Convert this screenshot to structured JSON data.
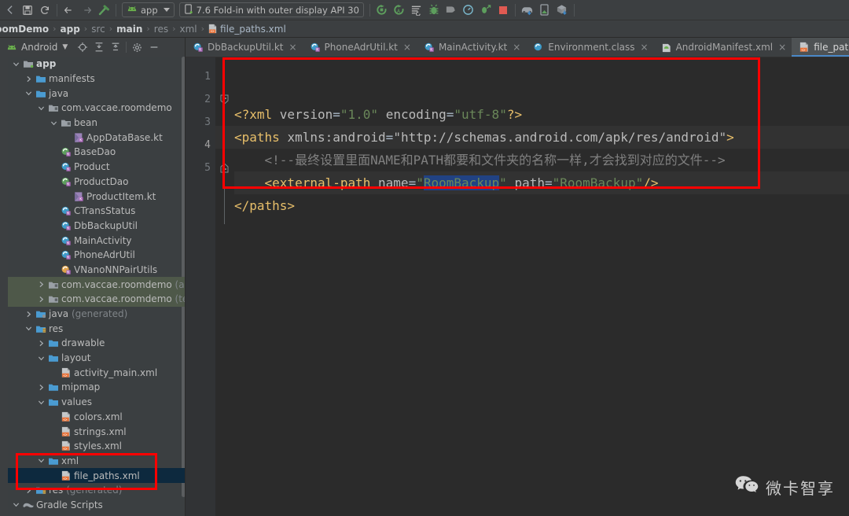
{
  "toolbar": {
    "icons": [
      "back-nav-icon",
      "save-icon",
      "sync-icon",
      "arrow-left-icon",
      "arrow-right-icon",
      "build-hammer-icon"
    ],
    "module_selector": {
      "label": "app",
      "icon": "android-icon"
    },
    "device_selector": {
      "label": "7.6  Fold-in with outer display API 30",
      "icon": "device-icon"
    },
    "run_icons": [
      "run-icon",
      "run-with-coverage-icon",
      "logcat-icon",
      "debug-icon",
      "attach-debugger-icon",
      "profiler-icon",
      "apply-changes-icon",
      "stop-icon"
    ],
    "right_icons": [
      "avd-manager-icon",
      "device-manager-icon",
      "sdk-manager-icon"
    ]
  },
  "breadcrumb": {
    "items": [
      {
        "label": "RoomDemo",
        "style": "bold"
      },
      {
        "label": "app",
        "style": "bold"
      },
      {
        "label": "src",
        "style": "dim"
      },
      {
        "label": "main",
        "style": "bold"
      },
      {
        "label": "res",
        "style": "dim"
      },
      {
        "label": "xml",
        "style": "dim"
      },
      {
        "label": "file_paths.xml",
        "style": "file",
        "icon": "xml-file-icon"
      }
    ],
    "separator": "›"
  },
  "project_panel": {
    "title": "Android",
    "title_icon": "android-icon",
    "caret": "▾",
    "toolbar_icons": [
      "select-opened-file-icon",
      "expand-all-icon",
      "collapse-all-icon",
      "settings-gear-icon",
      "hide-icon"
    ],
    "tree": [
      {
        "depth": 0,
        "arrow": "down",
        "icon": "module-folder",
        "label": "app",
        "bold": true
      },
      {
        "depth": 1,
        "arrow": "right",
        "icon": "folder",
        "label": "manifests"
      },
      {
        "depth": 1,
        "arrow": "down",
        "icon": "folder",
        "label": "java"
      },
      {
        "depth": 2,
        "arrow": "down",
        "icon": "package",
        "label": "com.vaccae.roomdemo"
      },
      {
        "depth": 3,
        "arrow": "down",
        "icon": "package",
        "label": "bean"
      },
      {
        "depth": 4,
        "arrow": "none",
        "icon": "kotlin-class",
        "label": "AppDataBase.kt"
      },
      {
        "depth": 3,
        "arrow": "none",
        "icon": "kotlin-green",
        "label": "BaseDao"
      },
      {
        "depth": 3,
        "arrow": "none",
        "icon": "kotlin-blue",
        "label": "Product"
      },
      {
        "depth": 3,
        "arrow": "none",
        "icon": "kotlin-green",
        "label": "ProductDao"
      },
      {
        "depth": 4,
        "arrow": "none",
        "icon": "kotlin-class",
        "label": "ProductItem.kt"
      },
      {
        "depth": 3,
        "arrow": "none",
        "icon": "kotlin-blue",
        "label": "CTransStatus"
      },
      {
        "depth": 3,
        "arrow": "none",
        "icon": "kotlin-blue",
        "label": "DbBackupUtil"
      },
      {
        "depth": 3,
        "arrow": "none",
        "icon": "kotlin-blue",
        "label": "MainActivity"
      },
      {
        "depth": 3,
        "arrow": "none",
        "icon": "kotlin-blue",
        "label": "PhoneAdrUtil"
      },
      {
        "depth": 3,
        "arrow": "none",
        "icon": "kotlin-orange",
        "label": "VNanoNNPairUtils"
      },
      {
        "depth": 2,
        "arrow": "right",
        "icon": "package",
        "label": "com.vaccae.roomdemo",
        "suffix": " (andr",
        "highlight": "green"
      },
      {
        "depth": 2,
        "arrow": "right",
        "icon": "package",
        "label": "com.vaccae.roomdemo",
        "suffix": " (test)",
        "highlight": "green"
      },
      {
        "depth": 1,
        "arrow": "right",
        "icon": "folder-gen",
        "label": "java",
        "suffix": " (generated)"
      },
      {
        "depth": 1,
        "arrow": "down",
        "icon": "res-folder",
        "label": "res"
      },
      {
        "depth": 2,
        "arrow": "right",
        "icon": "folder",
        "label": "drawable"
      },
      {
        "depth": 2,
        "arrow": "down",
        "icon": "folder",
        "label": "layout"
      },
      {
        "depth": 3,
        "arrow": "none",
        "icon": "xml-file",
        "label": "activity_main.xml"
      },
      {
        "depth": 2,
        "arrow": "right",
        "icon": "folder",
        "label": "mipmap"
      },
      {
        "depth": 2,
        "arrow": "down",
        "icon": "folder",
        "label": "values"
      },
      {
        "depth": 3,
        "arrow": "none",
        "icon": "xml-file",
        "label": "colors.xml"
      },
      {
        "depth": 3,
        "arrow": "none",
        "icon": "xml-file",
        "label": "strings.xml"
      },
      {
        "depth": 3,
        "arrow": "none",
        "icon": "xml-file",
        "label": "styles.xml"
      },
      {
        "depth": 2,
        "arrow": "down",
        "icon": "folder",
        "label": "xml"
      },
      {
        "depth": 3,
        "arrow": "none",
        "icon": "xml-file",
        "label": "file_paths.xml",
        "highlight": "blue"
      },
      {
        "depth": 1,
        "arrow": "right",
        "icon": "res-folder",
        "label": "res",
        "suffix": " (generated)"
      },
      {
        "depth": 0,
        "arrow": "down",
        "icon": "gradle",
        "label": "Gradle Scripts"
      }
    ]
  },
  "editor_tabs": [
    {
      "label": "DbBackupUtil.kt",
      "icon": "kotlin-blue",
      "active": false,
      "close": "×"
    },
    {
      "label": "PhoneAdrUtil.kt",
      "icon": "kotlin-blue",
      "active": false,
      "close": "×"
    },
    {
      "label": "MainActivity.kt",
      "icon": "kotlin-blue",
      "active": false,
      "close": "×"
    },
    {
      "label": "Environment.class",
      "icon": "class-blue",
      "active": false,
      "close": "×"
    },
    {
      "label": "AndroidManifest.xml",
      "icon": "manifest",
      "active": false,
      "close": "×"
    },
    {
      "label": "file_paths.xml",
      "icon": "xml-file",
      "active": true,
      "close": "×"
    }
  ],
  "editor": {
    "line_numbers": [
      "1",
      "2",
      "3",
      "4",
      "5"
    ],
    "current_line": 4,
    "lines": [
      {
        "n": 1,
        "tokens": [
          {
            "t": "<?xml ",
            "c": "tag"
          },
          {
            "t": "version",
            "c": "attr"
          },
          {
            "t": "=",
            "c": "plain"
          },
          {
            "t": "\"1.0\"",
            "c": "str"
          },
          {
            "t": " ",
            "c": "plain"
          },
          {
            "t": "encoding",
            "c": "attr"
          },
          {
            "t": "=",
            "c": "plain"
          },
          {
            "t": "\"utf-8\"",
            "c": "str"
          },
          {
            "t": "?>",
            "c": "tag"
          }
        ]
      },
      {
        "n": 2,
        "tokens": [
          {
            "t": "<paths ",
            "c": "tag"
          },
          {
            "t": "xmlns:android",
            "c": "attr"
          },
          {
            "t": "=",
            "c": "plain"
          },
          {
            "t": "\"http://schemas.android.com/apk/res/android\"",
            "c": "str-gray"
          },
          {
            "t": ">",
            "c": "tag"
          }
        ]
      },
      {
        "n": 3,
        "tokens": [
          {
            "t": "    <!--最终设置里面NAME和PATH都要和文件夹的名称一样,才会找到对应的文件-->",
            "c": "cmt"
          }
        ]
      },
      {
        "n": 4,
        "tokens": [
          {
            "t": "    <external-path ",
            "c": "tag"
          },
          {
            "t": "name",
            "c": "attr"
          },
          {
            "t": "=",
            "c": "plain"
          },
          {
            "t": "\"",
            "c": "str"
          },
          {
            "t": "RoomBackup",
            "c": "str-sel"
          },
          {
            "t": "\"",
            "c": "str"
          },
          {
            "t": " ",
            "c": "plain"
          },
          {
            "t": "path",
            "c": "attr"
          },
          {
            "t": "=",
            "c": "plain"
          },
          {
            "t": "\"RoomBackup\"",
            "c": "str"
          },
          {
            "t": "/>",
            "c": "tag"
          }
        ]
      },
      {
        "n": 5,
        "tokens": [
          {
            "t": "</paths>",
            "c": "tag"
          }
        ]
      }
    ]
  },
  "annotations": {
    "code_box_label": "code-highlight-box",
    "tree_box_label": "xml-folder-highlight-box",
    "color": "#ff0000"
  },
  "watermark": {
    "text": "微卡智享",
    "icon": "wechat-icon"
  },
  "colors": {
    "accent": "#4a88c7",
    "editor_bg": "#2b2b2b",
    "panel_bg": "#3c3f41",
    "tag": "#e8bf6a",
    "string": "#6a8759",
    "comment": "#808080",
    "selection": "#214283",
    "annotation": "#ff0000"
  }
}
